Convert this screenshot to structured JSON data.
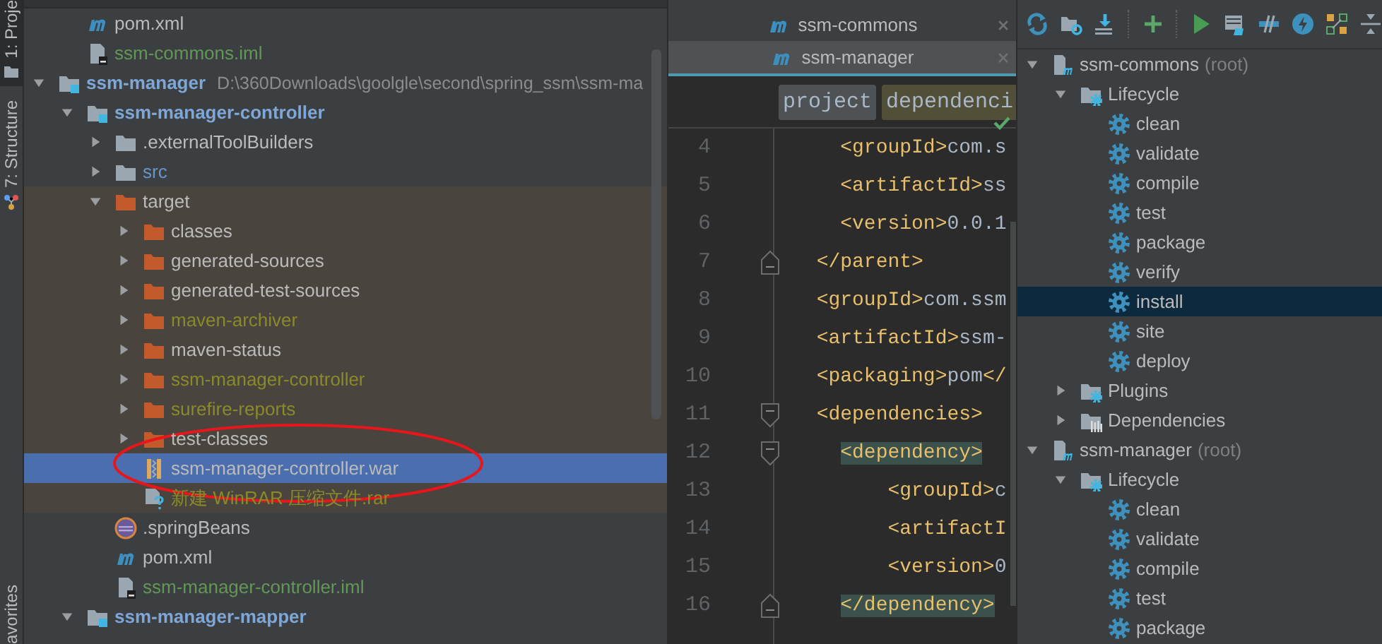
{
  "tool_strip": [
    {
      "label": "1: Proje",
      "kind": "project",
      "selected": true
    },
    {
      "label": "7: Structure",
      "kind": "structure",
      "selected": false
    },
    {
      "label": "avorites",
      "kind": "favorites",
      "selected": false
    }
  ],
  "project_tree": {
    "cut_off_items": [
      {
        "label": "pom.xml",
        "kind": "maven",
        "color": "#bbbbbb",
        "selected": false
      },
      {
        "label": "ssm-commons.iml",
        "kind": "iml",
        "color": "#629755",
        "selected": false
      }
    ],
    "items": [
      {
        "label": "ssm-manager",
        "path": "D:\\360Downloads\\goolgle\\second\\spring_ssm\\ssm-ma",
        "kind": "module",
        "color": "#7ea6d6",
        "expanded": true,
        "selected": false,
        "children": [
          {
            "label": "ssm-manager-controller",
            "kind": "module",
            "color": "#7ea6d6",
            "expanded": true,
            "selected": false,
            "children": [
              {
                "label": ".externalToolBuilders",
                "kind": "folder",
                "color": "#bbbbbb",
                "expanded": false,
                "selected": false
              },
              {
                "label": "src",
                "kind": "folder",
                "color": "#6a95c9",
                "expanded": false,
                "selected": false
              },
              {
                "label": "target",
                "kind": "excluded-folder",
                "color": "#bbbbbb",
                "expanded": true,
                "excluded": true,
                "selected": false,
                "children": [
                  {
                    "label": "classes",
                    "kind": "excluded-folder",
                    "color": "#bbbbbb",
                    "expanded": false,
                    "selected": false
                  },
                  {
                    "label": "generated-sources",
                    "kind": "excluded-folder",
                    "color": "#bbbbbb",
                    "expanded": false,
                    "selected": false
                  },
                  {
                    "label": "generated-test-sources",
                    "kind": "excluded-folder",
                    "color": "#bbbbbb",
                    "expanded": false,
                    "selected": false
                  },
                  {
                    "label": "maven-archiver",
                    "kind": "excluded-folder",
                    "color": "#8a8a2a",
                    "expanded": false,
                    "selected": false
                  },
                  {
                    "label": "maven-status",
                    "kind": "excluded-folder",
                    "color": "#bbbbbb",
                    "expanded": false,
                    "selected": false
                  },
                  {
                    "label": "ssm-manager-controller",
                    "kind": "excluded-folder",
                    "color": "#8a8a2a",
                    "expanded": false,
                    "selected": false
                  },
                  {
                    "label": "surefire-reports",
                    "kind": "excluded-folder",
                    "color": "#8a8a2a",
                    "expanded": false,
                    "selected": false
                  },
                  {
                    "label": "test-classes",
                    "kind": "excluded-folder",
                    "color": "#bbbbbb",
                    "expanded": false,
                    "selected": false
                  },
                  {
                    "label": "ssm-manager-controller.war",
                    "kind": "war",
                    "color": "#bbbbbb",
                    "selected": true,
                    "circled": true
                  },
                  {
                    "label": "新建 WinRAR 压缩文件.rar",
                    "kind": "unknown",
                    "color": "#8a8a2a",
                    "selected": false
                  }
                ]
              },
              {
                "label": ".springBeans",
                "kind": "spring",
                "color": "#bbbbbb",
                "selected": false
              },
              {
                "label": "pom.xml",
                "kind": "maven",
                "color": "#bbbbbb",
                "selected": false
              },
              {
                "label": "ssm-manager-controller.iml",
                "kind": "iml",
                "color": "#629755",
                "selected": false
              }
            ]
          },
          {
            "label": "ssm-manager-mapper",
            "kind": "module",
            "color": "#7ea6d6",
            "expanded": true,
            "selected": false
          }
        ]
      }
    ]
  },
  "editor": {
    "tabs": [
      {
        "label": "ssm-commons",
        "selected": false
      },
      {
        "label": "ssm-manager",
        "selected": true
      }
    ],
    "breadcrumbs": [
      {
        "label": "project",
        "selected": false
      },
      {
        "label": "dependenci",
        "selected": true
      }
    ],
    "lines": [
      {
        "number": "4",
        "tokens": [
          {
            "text": "    <groupId>",
            "kind": "tag"
          },
          {
            "text": "com.s",
            "kind": "text"
          }
        ],
        "fold_start": false,
        "fold_end": false,
        "highlighted": false
      },
      {
        "number": "5",
        "tokens": [
          {
            "text": "    <artifactId>",
            "kind": "tag"
          },
          {
            "text": "ss",
            "kind": "text"
          }
        ],
        "fold_start": false,
        "fold_end": false,
        "highlighted": false
      },
      {
        "number": "6",
        "tokens": [
          {
            "text": "    <version>",
            "kind": "tag"
          },
          {
            "text": "0.0.1",
            "kind": "text"
          }
        ],
        "fold_start": false,
        "fold_end": false,
        "highlighted": false
      },
      {
        "number": "7",
        "tokens": [
          {
            "text": "  </parent>",
            "kind": "tag"
          }
        ],
        "fold_start": false,
        "fold_end": true,
        "highlighted": false
      },
      {
        "number": "8",
        "tokens": [
          {
            "text": "  <groupId>",
            "kind": "tag"
          },
          {
            "text": "com.ssm",
            "kind": "text"
          }
        ],
        "fold_start": false,
        "fold_end": false,
        "highlighted": false
      },
      {
        "number": "9",
        "tokens": [
          {
            "text": "  <artifactId>",
            "kind": "tag"
          },
          {
            "text": "ssm-",
            "kind": "text"
          }
        ],
        "fold_start": false,
        "fold_end": false,
        "highlighted": false
      },
      {
        "number": "10",
        "tokens": [
          {
            "text": "  <packaging>",
            "kind": "tag"
          },
          {
            "text": "pom",
            "kind": "text"
          },
          {
            "text": "</",
            "kind": "tag"
          }
        ],
        "fold_start": false,
        "fold_end": false,
        "highlighted": false
      },
      {
        "number": "11",
        "tokens": [
          {
            "text": "  <dependencies>",
            "kind": "tag"
          }
        ],
        "fold_start": true,
        "fold_end": false,
        "highlighted": false
      },
      {
        "number": "12",
        "tokens": [
          {
            "text": "    <dependency>",
            "kind": "tag"
          }
        ],
        "fold_start": true,
        "fold_end": false,
        "highlighted": true
      },
      {
        "number": "13",
        "tokens": [
          {
            "text": "        <groupId>",
            "kind": "tag"
          },
          {
            "text": "c",
            "kind": "text"
          }
        ],
        "fold_start": false,
        "fold_end": false,
        "highlighted": false
      },
      {
        "number": "14",
        "tokens": [
          {
            "text": "        <artifactI",
            "kind": "tag"
          }
        ],
        "fold_start": false,
        "fold_end": false,
        "highlighted": false
      },
      {
        "number": "15",
        "tokens": [
          {
            "text": "        <version>",
            "kind": "tag"
          },
          {
            "text": "0",
            "kind": "text"
          }
        ],
        "fold_start": false,
        "fold_end": false,
        "highlighted": false
      },
      {
        "number": "16",
        "tokens": [
          {
            "text": "    </dependency>",
            "kind": "tag"
          }
        ],
        "fold_start": false,
        "fold_end": true,
        "highlighted": true
      }
    ]
  },
  "maven_tree": [
    {
      "label": "ssm-commons",
      "suffix": "(root)",
      "kind": "project",
      "expanded": true,
      "selected": false,
      "children": [
        {
          "label": "Lifecycle",
          "kind": "lifecycle",
          "expanded": true,
          "selected": false,
          "children": [
            {
              "label": "clean",
              "kind": "goal",
              "selected": false
            },
            {
              "label": "validate",
              "kind": "goal",
              "selected": false
            },
            {
              "label": "compile",
              "kind": "goal",
              "selected": false
            },
            {
              "label": "test",
              "kind": "goal",
              "selected": false
            },
            {
              "label": "package",
              "kind": "goal",
              "selected": false
            },
            {
              "label": "verify",
              "kind": "goal",
              "selected": false
            },
            {
              "label": "install",
              "kind": "goal",
              "selected": true
            },
            {
              "label": "site",
              "kind": "goal",
              "selected": false
            },
            {
              "label": "deploy",
              "kind": "goal",
              "selected": false
            }
          ]
        },
        {
          "label": "Plugins",
          "kind": "plugins",
          "expanded": false,
          "selected": false
        },
        {
          "label": "Dependencies",
          "kind": "dependencies",
          "expanded": false,
          "selected": false
        }
      ]
    },
    {
      "label": "ssm-manager",
      "suffix": "(root)",
      "kind": "project",
      "expanded": true,
      "selected": false,
      "children": [
        {
          "label": "Lifecycle",
          "kind": "lifecycle",
          "expanded": true,
          "selected": false,
          "children": [
            {
              "label": "clean",
              "kind": "goal",
              "selected": false
            },
            {
              "label": "validate",
              "kind": "goal",
              "selected": false
            },
            {
              "label": "compile",
              "kind": "goal",
              "selected": false
            },
            {
              "label": "test",
              "kind": "goal",
              "selected": false
            },
            {
              "label": "package",
              "kind": "goal",
              "selected": false
            }
          ]
        }
      ]
    }
  ]
}
